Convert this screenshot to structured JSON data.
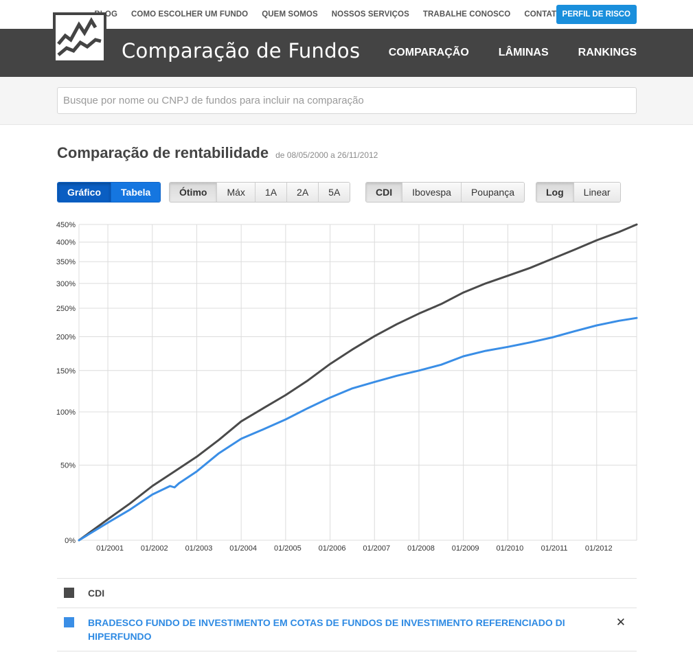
{
  "topnav": {
    "links": [
      "BLOG",
      "COMO ESCOLHER UM FUNDO",
      "QUEM SOMOS",
      "NOSSOS SERVIÇOS",
      "TRABALHE CONOSCO",
      "CONTATO"
    ],
    "risk_button": "PERFIL DE RISCO"
  },
  "header": {
    "brand": "Comparação de Fundos",
    "nav": [
      "COMPARAÇÃO",
      "LÂMINAS",
      "RANKINGS"
    ]
  },
  "search": {
    "placeholder": "Busque por nome ou CNPJ de fundos para incluir na comparação",
    "value": ""
  },
  "page": {
    "title": "Comparação de rentabilidade",
    "date_range": "de 08/05/2000 a 26/11/2012"
  },
  "controls": {
    "view": {
      "options": [
        "Gráfico",
        "Tabela"
      ],
      "selected": "Gráfico"
    },
    "period": {
      "options": [
        "Ótimo",
        "Máx",
        "1A",
        "2A",
        "5A"
      ],
      "selected": "Ótimo"
    },
    "benchmark": {
      "options": [
        "CDI",
        "Ibovespa",
        "Poupança"
      ],
      "selected": "CDI"
    },
    "scale": {
      "options": [
        "Log",
        "Linear"
      ],
      "selected": "Log"
    }
  },
  "colors": {
    "cdi": "#4a4a4a",
    "fund": "#3a8ee6",
    "grid": "#dcdcdc"
  },
  "chart_data": {
    "type": "line",
    "yscale": "log(1+r)",
    "y_ticks": [
      0,
      50,
      100,
      150,
      200,
      250,
      300,
      350,
      400,
      450
    ],
    "y_tick_labels": [
      "0%",
      "50%",
      "100%",
      "150%",
      "200%",
      "250%",
      "300%",
      "350%",
      "400%",
      "450%"
    ],
    "x_ticks": [
      2001,
      2002,
      2003,
      2004,
      2005,
      2006,
      2007,
      2008,
      2009,
      2010,
      2011,
      2012
    ],
    "x_tick_labels": [
      "01/2001",
      "01/2002",
      "01/2003",
      "01/2004",
      "01/2005",
      "01/2006",
      "01/2007",
      "01/2008",
      "01/2009",
      "01/2010",
      "01/2011",
      "01/2012"
    ],
    "xlim": [
      2000.35,
      2012.9
    ],
    "ylim": [
      0,
      450
    ],
    "grid": true,
    "series": [
      {
        "name": "CDI",
        "x": [
          2000.35,
          2001.0,
          2001.5,
          2002.0,
          2002.5,
          2003.0,
          2003.5,
          2004.0,
          2004.5,
          2005.0,
          2005.5,
          2006.0,
          2006.5,
          2007.0,
          2007.5,
          2008.0,
          2008.5,
          2009.0,
          2009.5,
          2010.0,
          2010.5,
          2011.0,
          2011.5,
          2012.0,
          2012.5,
          2012.9
        ],
        "values": [
          0,
          12,
          22,
          34,
          45,
          57,
          72,
          90,
          104,
          119,
          137,
          159,
          180,
          201,
          221,
          240,
          258,
          281,
          300,
          317,
          335,
          357,
          380,
          405,
          428,
          450
        ]
      },
      {
        "name": "BRADESCO FUNDO DE INVESTIMENTO EM COTAS DE FUNDOS DE INVESTIMENTO REFERENCIADO DI HIPERFUNDO",
        "x": [
          2000.35,
          2001.0,
          2001.5,
          2002.0,
          2002.4,
          2002.5,
          2002.6,
          2003.0,
          2003.5,
          2004.0,
          2004.5,
          2005.0,
          2005.5,
          2006.0,
          2006.5,
          2007.0,
          2007.5,
          2008.0,
          2008.5,
          2009.0,
          2009.5,
          2010.0,
          2010.5,
          2011.0,
          2011.5,
          2012.0,
          2012.5,
          2012.9
        ],
        "values": [
          0,
          10,
          18,
          28,
          34,
          33,
          36,
          45,
          60,
          73,
          82,
          92,
          104,
          116,
          127,
          135,
          143,
          150,
          158,
          170,
          178,
          184,
          191,
          199,
          209,
          219,
          227,
          232
        ]
      }
    ]
  },
  "legend": [
    {
      "name": "CDI",
      "color": "#4a4a4a",
      "removable": false
    },
    {
      "name": "BRADESCO FUNDO DE INVESTIMENTO EM COTAS DE FUNDOS DE INVESTIMENTO REFERENCIADO DI HIPERFUNDO",
      "color": "#3a8ee6",
      "removable": true,
      "remove_glyph": "✕"
    }
  ]
}
